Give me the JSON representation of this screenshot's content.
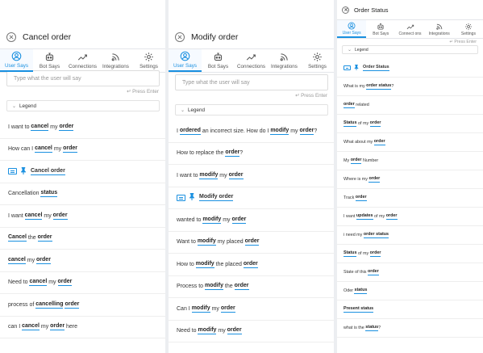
{
  "theme": {
    "accent": "#1a90e0"
  },
  "tabs": [
    {
      "label": "User Says",
      "icon": "user-circle-icon"
    },
    {
      "label": "Bot Says",
      "icon": "robot-icon"
    },
    {
      "label": "Connections",
      "icon": "trend-line-icon"
    },
    {
      "label": "Integrations",
      "icon": "broadcast-icon"
    },
    {
      "label": "Settings",
      "icon": "gear-icon"
    }
  ],
  "tabs_small": [
    {
      "label": "User Says"
    },
    {
      "label": "Bot Says"
    },
    {
      "label": "Connect ons"
    },
    {
      "label": "Integrations"
    },
    {
      "label": "Settings"
    }
  ],
  "input": {
    "placeholder": "Type what the user will say"
  },
  "press_enter": "Press Enter",
  "legend": "Legend",
  "panels": [
    {
      "title": "Cancel order",
      "rows": [
        {
          "type": "phrase",
          "parts": [
            {
              "t": "I want to "
            },
            {
              "t": "cancel",
              "k": 1
            },
            {
              "t": " my "
            },
            {
              "t": "order",
              "k": 1
            }
          ]
        },
        {
          "type": "phrase",
          "parts": [
            {
              "t": "How can I "
            },
            {
              "t": "cancel",
              "k": 1
            },
            {
              "t": " my "
            },
            {
              "t": "order",
              "k": 1
            }
          ]
        },
        {
          "type": "intent",
          "label": "Cancel order"
        },
        {
          "type": "phrase",
          "parts": [
            {
              "t": "Cancellation "
            },
            {
              "t": "status",
              "k": 1
            }
          ]
        },
        {
          "type": "phrase",
          "parts": [
            {
              "t": "I want "
            },
            {
              "t": "cancel",
              "k": 1
            },
            {
              "t": " my "
            },
            {
              "t": "order",
              "k": 1
            }
          ]
        },
        {
          "type": "phrase",
          "parts": [
            {
              "t": "Cancel",
              "k": 1
            },
            {
              "t": " the "
            },
            {
              "t": "order",
              "k": 1
            }
          ]
        },
        {
          "type": "phrase",
          "parts": [
            {
              "t": "cancel",
              "k": 1
            },
            {
              "t": " my "
            },
            {
              "t": "order",
              "k": 1
            }
          ]
        },
        {
          "type": "phrase",
          "parts": [
            {
              "t": "Need to "
            },
            {
              "t": "cancel",
              "k": 1
            },
            {
              "t": " my "
            },
            {
              "t": "order",
              "k": 1
            }
          ]
        },
        {
          "type": "phrase",
          "parts": [
            {
              "t": "process of "
            },
            {
              "t": "cancelling",
              "k": 1
            },
            {
              "t": " "
            },
            {
              "t": "order",
              "k": 1
            }
          ]
        },
        {
          "type": "phrase",
          "parts": [
            {
              "t": "can I "
            },
            {
              "t": "cancel",
              "k": 1
            },
            {
              "t": " my "
            },
            {
              "t": "order",
              "k": 1
            },
            {
              "t": " here"
            }
          ]
        }
      ]
    },
    {
      "title": "Modify order",
      "rows": [
        {
          "type": "phrase",
          "parts": [
            {
              "t": "I "
            },
            {
              "t": "ordered",
              "k": 1
            },
            {
              "t": " an incorrect size. How do I "
            },
            {
              "t": "modify",
              "k": 1
            },
            {
              "t": " my "
            },
            {
              "t": "order",
              "k": 1
            },
            {
              "t": "?"
            }
          ]
        },
        {
          "type": "phrase",
          "parts": [
            {
              "t": "How to replace the "
            },
            {
              "t": "order",
              "k": 1
            },
            {
              "t": "?"
            }
          ]
        },
        {
          "type": "phrase",
          "parts": [
            {
              "t": "I want to "
            },
            {
              "t": "modify",
              "k": 1
            },
            {
              "t": " my "
            },
            {
              "t": "order",
              "k": 1
            }
          ]
        },
        {
          "type": "intent",
          "label": "Modify order"
        },
        {
          "type": "phrase",
          "parts": [
            {
              "t": "wanted to "
            },
            {
              "t": "modify",
              "k": 1
            },
            {
              "t": " my "
            },
            {
              "t": "order",
              "k": 1
            }
          ]
        },
        {
          "type": "phrase",
          "parts": [
            {
              "t": "Want to "
            },
            {
              "t": "modify",
              "k": 1
            },
            {
              "t": " my placed "
            },
            {
              "t": "order",
              "k": 1
            }
          ]
        },
        {
          "type": "phrase",
          "parts": [
            {
              "t": "How to "
            },
            {
              "t": "modify",
              "k": 1
            },
            {
              "t": " the placed "
            },
            {
              "t": "order",
              "k": 1
            }
          ]
        },
        {
          "type": "phrase",
          "parts": [
            {
              "t": "Process to "
            },
            {
              "t": "modify",
              "k": 1
            },
            {
              "t": " the "
            },
            {
              "t": "order",
              "k": 1
            }
          ]
        },
        {
          "type": "phrase",
          "parts": [
            {
              "t": "Can I "
            },
            {
              "t": "modify",
              "k": 1
            },
            {
              "t": " my "
            },
            {
              "t": "order",
              "k": 1
            }
          ]
        },
        {
          "type": "phrase",
          "parts": [
            {
              "t": "Need to "
            },
            {
              "t": "modify",
              "k": 1
            },
            {
              "t": " my "
            },
            {
              "t": "order",
              "k": 1
            }
          ]
        }
      ]
    },
    {
      "title": "Order Status",
      "rows": [
        {
          "type": "intent",
          "label": "Order Status"
        },
        {
          "type": "phrase",
          "parts": [
            {
              "t": "What is my "
            },
            {
              "t": "order status",
              "k": 1
            },
            {
              "t": "?"
            }
          ]
        },
        {
          "type": "phrase",
          "parts": [
            {
              "t": "order",
              "k": 1
            },
            {
              "t": " related"
            }
          ]
        },
        {
          "type": "phrase",
          "parts": [
            {
              "t": "Status",
              "k": 1
            },
            {
              "t": " of my "
            },
            {
              "t": "order",
              "k": 1
            }
          ]
        },
        {
          "type": "phrase",
          "parts": [
            {
              "t": "What about my "
            },
            {
              "t": "order",
              "k": 1
            }
          ]
        },
        {
          "type": "phrase",
          "parts": [
            {
              "t": "My "
            },
            {
              "t": "order",
              "k": 1
            },
            {
              "t": " Number"
            }
          ]
        },
        {
          "type": "phrase",
          "parts": [
            {
              "t": "Where is my "
            },
            {
              "t": "order",
              "k": 1
            }
          ]
        },
        {
          "type": "phrase",
          "parts": [
            {
              "t": "Track "
            },
            {
              "t": "order",
              "k": 1
            }
          ]
        },
        {
          "type": "phrase",
          "parts": [
            {
              "t": "I want "
            },
            {
              "t": "updates",
              "k": 1
            },
            {
              "t": " of my "
            },
            {
              "t": "order",
              "k": 1
            }
          ]
        },
        {
          "type": "phrase",
          "parts": [
            {
              "t": "i need my "
            },
            {
              "t": "order status",
              "k": 1
            }
          ]
        },
        {
          "type": "phrase",
          "parts": [
            {
              "t": "Status",
              "k": 1
            },
            {
              "t": " of my "
            },
            {
              "t": "order",
              "k": 1
            }
          ]
        },
        {
          "type": "phrase",
          "parts": [
            {
              "t": "State of this "
            },
            {
              "t": "order",
              "k": 1
            }
          ]
        },
        {
          "type": "phrase",
          "parts": [
            {
              "t": "Oder "
            },
            {
              "t": "status",
              "k": 1
            }
          ]
        },
        {
          "type": "phrase",
          "parts": [
            {
              "t": "Present status",
              "k": 1
            }
          ]
        },
        {
          "type": "phrase",
          "parts": [
            {
              "t": "what is the "
            },
            {
              "t": "status",
              "k": 1
            },
            {
              "t": "?"
            }
          ]
        }
      ]
    }
  ]
}
